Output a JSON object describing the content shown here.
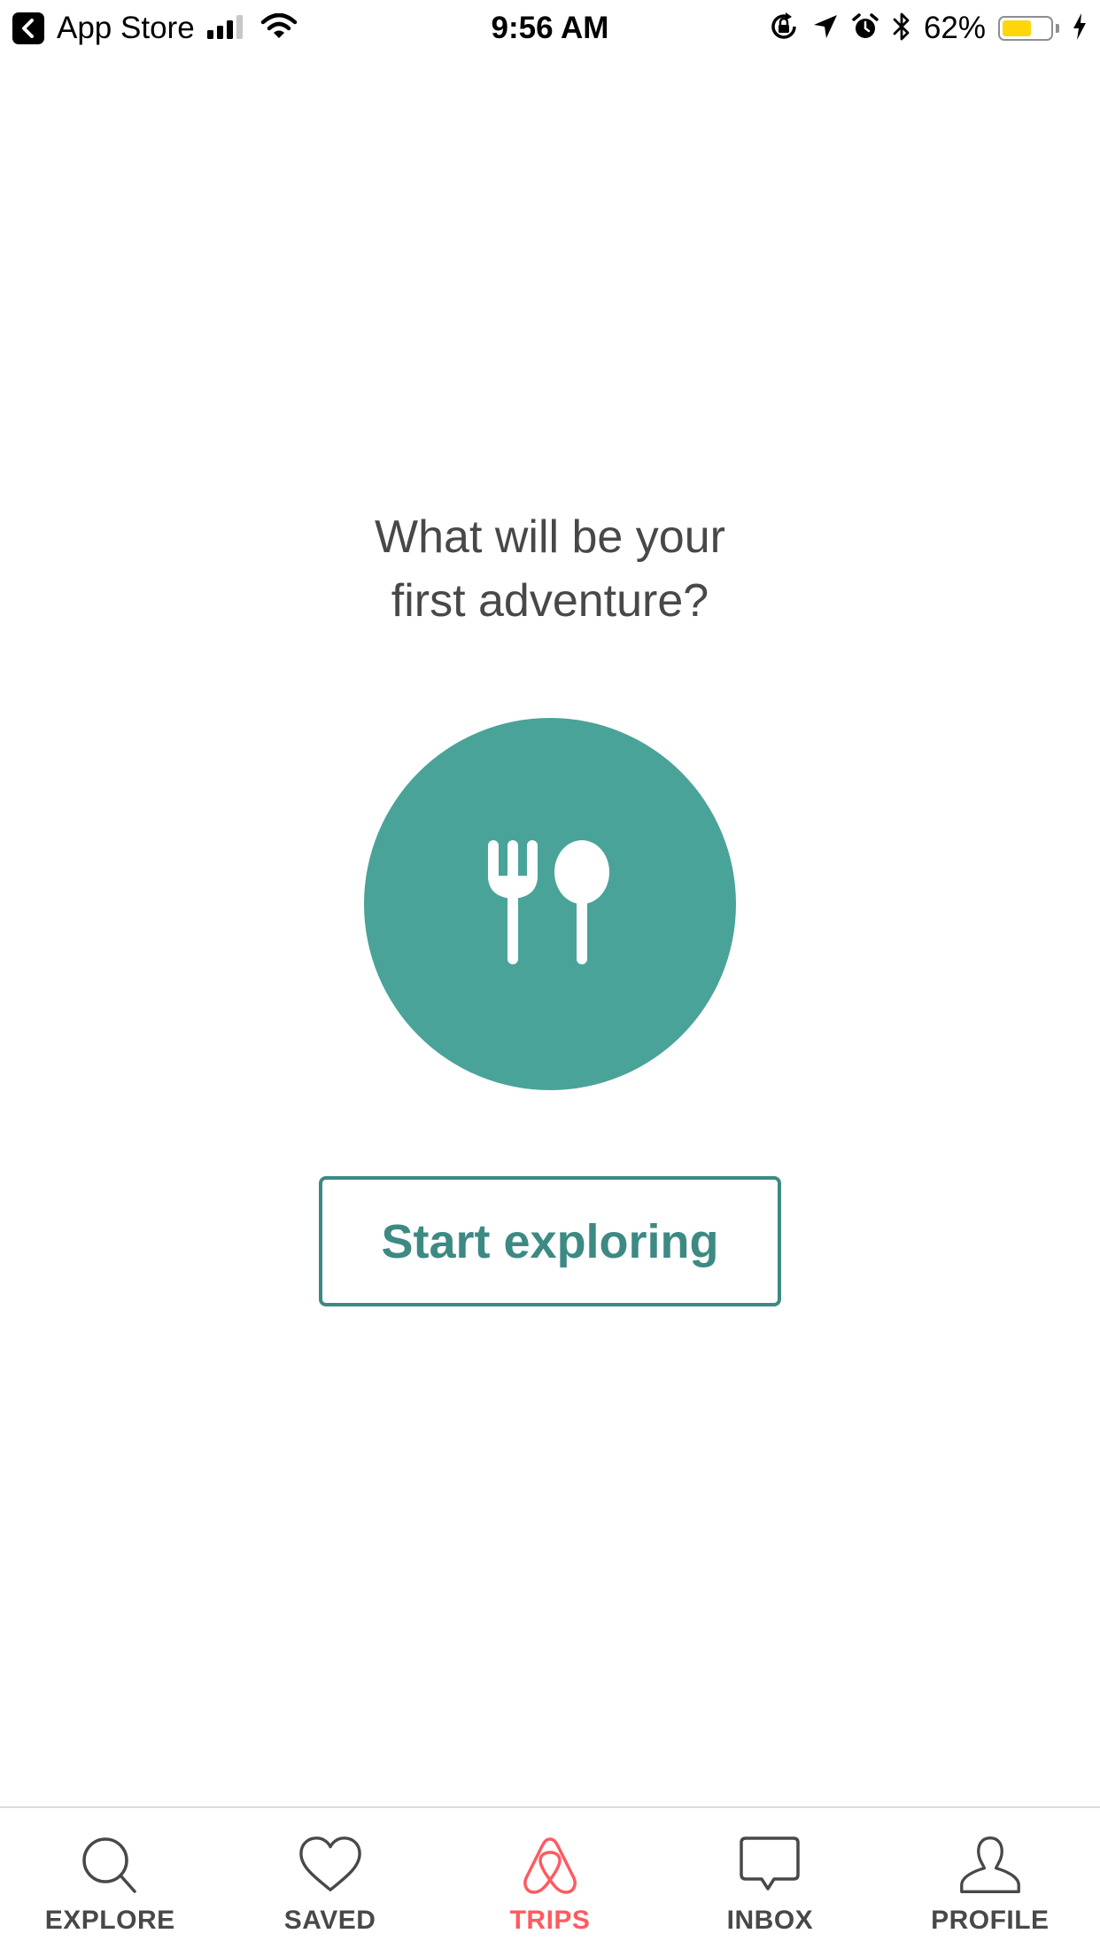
{
  "status_bar": {
    "back_app": "App Store",
    "time": "9:56 AM",
    "battery_percent": "62%",
    "battery_level": 0.62,
    "battery_color": "#ffd60a"
  },
  "main": {
    "headline_line1": "What will be your",
    "headline_line2": "first adventure?",
    "badge_icon": "fork-spoon-icon",
    "badge_color": "#4aa399",
    "cta_label": "Start exploring",
    "cta_color": "#3c8a83"
  },
  "tab_bar": {
    "active_color": "#ff5a5f",
    "inactive_color": "#484848",
    "items": [
      {
        "label": "EXPLORE",
        "icon": "search-icon",
        "active": false
      },
      {
        "label": "SAVED",
        "icon": "heart-icon",
        "active": false
      },
      {
        "label": "TRIPS",
        "icon": "airbnb-belo-icon",
        "active": true
      },
      {
        "label": "INBOX",
        "icon": "chat-bubble-icon",
        "active": false
      },
      {
        "label": "PROFILE",
        "icon": "person-icon",
        "active": false
      }
    ]
  }
}
